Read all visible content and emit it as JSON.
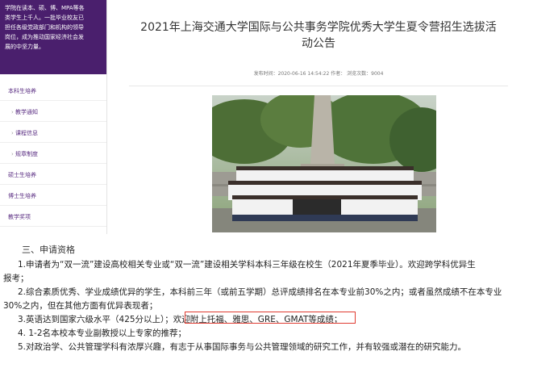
{
  "sidebar": {
    "intro": [
      "学院在读本、硕、博、MPA等各",
      "类学生上千人。一批毕业校友已",
      "担任各级党政部门和机构的领导",
      "岗位，成为推动国家经济社会发",
      "展的中坚力量。"
    ],
    "items": [
      {
        "label": "本科生培养",
        "sub": false
      },
      {
        "label": "教学通知",
        "sub": true
      },
      {
        "label": "课程信息",
        "sub": true
      },
      {
        "label": "规章制度",
        "sub": true
      },
      {
        "label": "硕士生培养",
        "sub": false
      },
      {
        "label": "博士生培养",
        "sub": false
      },
      {
        "label": "教学奖项",
        "sub": false
      }
    ]
  },
  "article": {
    "title_line1": "2021年上海交通大学国际与公共事务学院优秀大学生夏令营招生选拔活",
    "title_line2": "动公告",
    "meta": "发布时间：2020-06-16 14:54:22  作者：  浏览次数：9004"
  },
  "content": {
    "heading": "三、申请资格",
    "lines": [
      "1.申请者为“双一流”建设高校相关专业或“双一流”建设相关学科本科三年级在校生（2021年夏季毕业）。欢迎跨学科优异生",
      "报考；",
      "2.综合素质优秀、学业成绩优异的学生，本科前三年（或前五学期）总评成绩排名在本专业前30%之内；或者虽然成绩不在本专业",
      "30%之内，但在其他方面有优异表现者；",
      "3.英语达到国家六级水平（425分以上）；欢迎附上托福、雅思、GRE、GMAT等成绩；",
      "4. 1-2名本校本专业副教授以上专家的推荐；",
      "5.对政治学、公共管理学科有浓厚兴趣，有志于从事国际事务与公共管理领域的研究工作，并有较强或潜在的研究能力。"
    ]
  }
}
